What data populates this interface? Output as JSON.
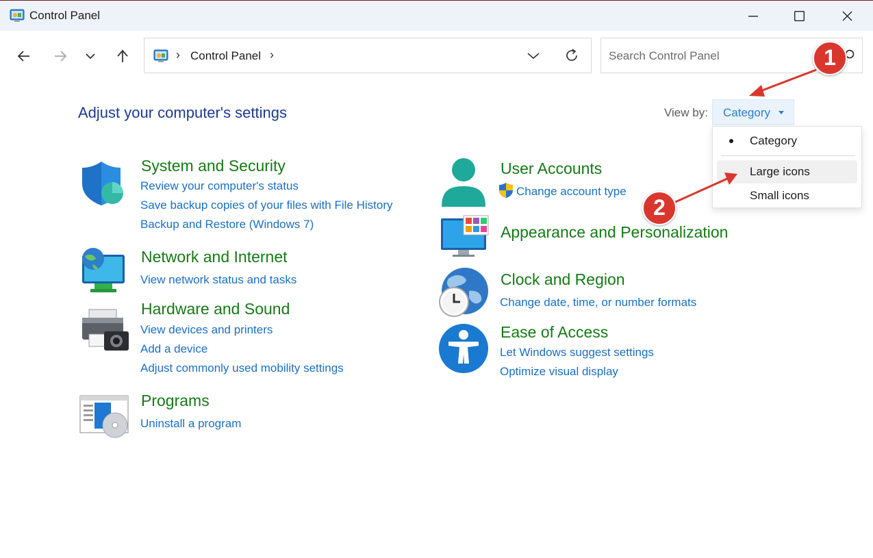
{
  "window": {
    "title": "Control Panel"
  },
  "nav": {
    "breadcrumb_root": "Control Panel",
    "search_placeholder": "Search Control Panel"
  },
  "main": {
    "heading": "Adjust your computer's settings",
    "view_by_label": "View by:",
    "view_by_value": "Category",
    "view_options": [
      "Category",
      "Large icons",
      "Small icons"
    ]
  },
  "categories": [
    {
      "title": "System and Security",
      "links": [
        "Review your computer's status",
        "Save backup copies of your files with File History",
        "Backup and Restore (Windows 7)"
      ]
    },
    {
      "title": "Network and Internet",
      "links": [
        "View network status and tasks"
      ]
    },
    {
      "title": "Hardware and Sound",
      "links": [
        "View devices and printers",
        "Add a device",
        "Adjust commonly used mobility settings"
      ]
    },
    {
      "title": "Programs",
      "links": [
        "Uninstall a program"
      ]
    },
    {
      "title": "User Accounts",
      "links": [
        "Change account type"
      ]
    },
    {
      "title": "Appearance and Personalization",
      "links": []
    },
    {
      "title": "Clock and Region",
      "links": [
        "Change date, time, or number formats"
      ]
    },
    {
      "title": "Ease of Access",
      "links": [
        "Let Windows suggest settings",
        "Optimize visual display"
      ]
    }
  ],
  "annotations": {
    "badge_1": "1",
    "badge_2": "2",
    "color": "#d9372e"
  }
}
